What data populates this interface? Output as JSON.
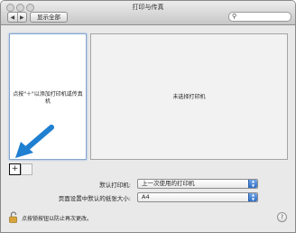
{
  "window": {
    "title": "打印与传真",
    "show_all_label": "显示全部",
    "nav_back_icon": "chevron-left-icon",
    "nav_forward_icon": "chevron-right-icon",
    "search_placeholder": ""
  },
  "printer_list": {
    "empty_message": "点按\"＋\"以添加打印机或传真机",
    "add_button_label": "+"
  },
  "detail": {
    "no_selection_message": "未选择打印机"
  },
  "settings": {
    "default_printer_label": "默认打印机:",
    "default_printer_value": "上一次使用的打印机",
    "paper_size_label": "页面设置中默认的纸张大小:",
    "paper_size_value": "A4"
  },
  "footer": {
    "lock_message": "点按锁按钮以防止再次更改。",
    "help_label": "?"
  },
  "colors": {
    "arrow": "#1f7fd1",
    "select_stepper": "#3a7bd5"
  }
}
